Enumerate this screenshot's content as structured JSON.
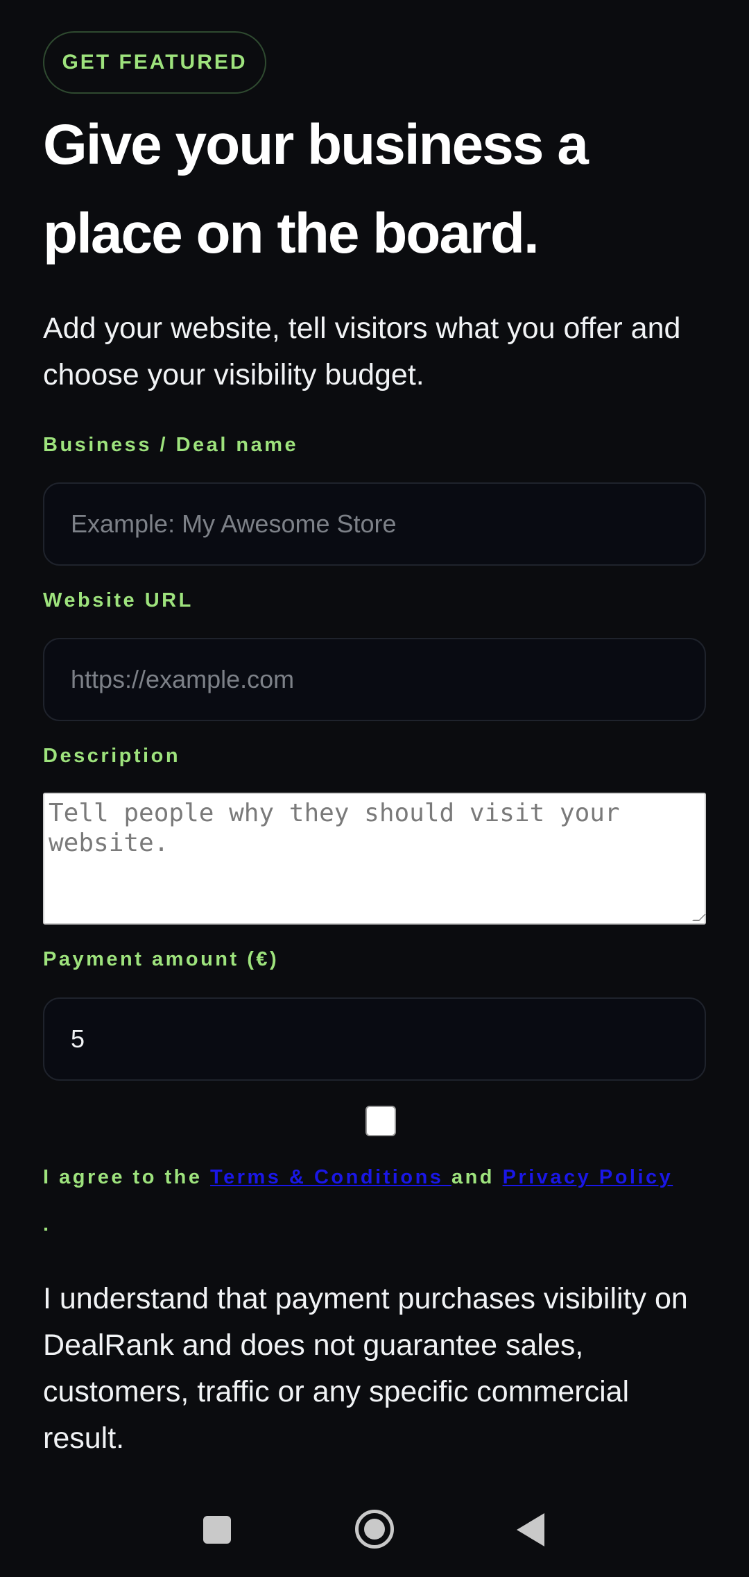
{
  "badge": "GET FEATURED",
  "title": "Give your business a place on the board.",
  "intro": "Add your website, tell visitors what you offer and choose your visibility budget.",
  "form": {
    "business_label": "Business / Deal name",
    "business_placeholder": "Example: My Awesome Store",
    "website_label": "Website URL",
    "website_placeholder": "https://example.com",
    "description_label": "Description",
    "description_placeholder": "Tell people why they should visit your website.",
    "payment_label": "Payment amount (€)",
    "payment_value": "5",
    "agree_prefix": "I agree to the ",
    "terms_link": "Terms & Conditions ",
    "agree_and": "and ",
    "privacy_link": "Privacy Policy",
    "agree_suffix": ".",
    "checkbox_checked": false
  },
  "disclaimer": "I understand that payment purchases visibility on DealRank and does not guarantee sales, customers, traffic or any specific commercial result.",
  "nav": {
    "recents_icon": "square-icon",
    "home_icon": "circle-home-icon",
    "back_icon": "triangle-back-icon"
  }
}
